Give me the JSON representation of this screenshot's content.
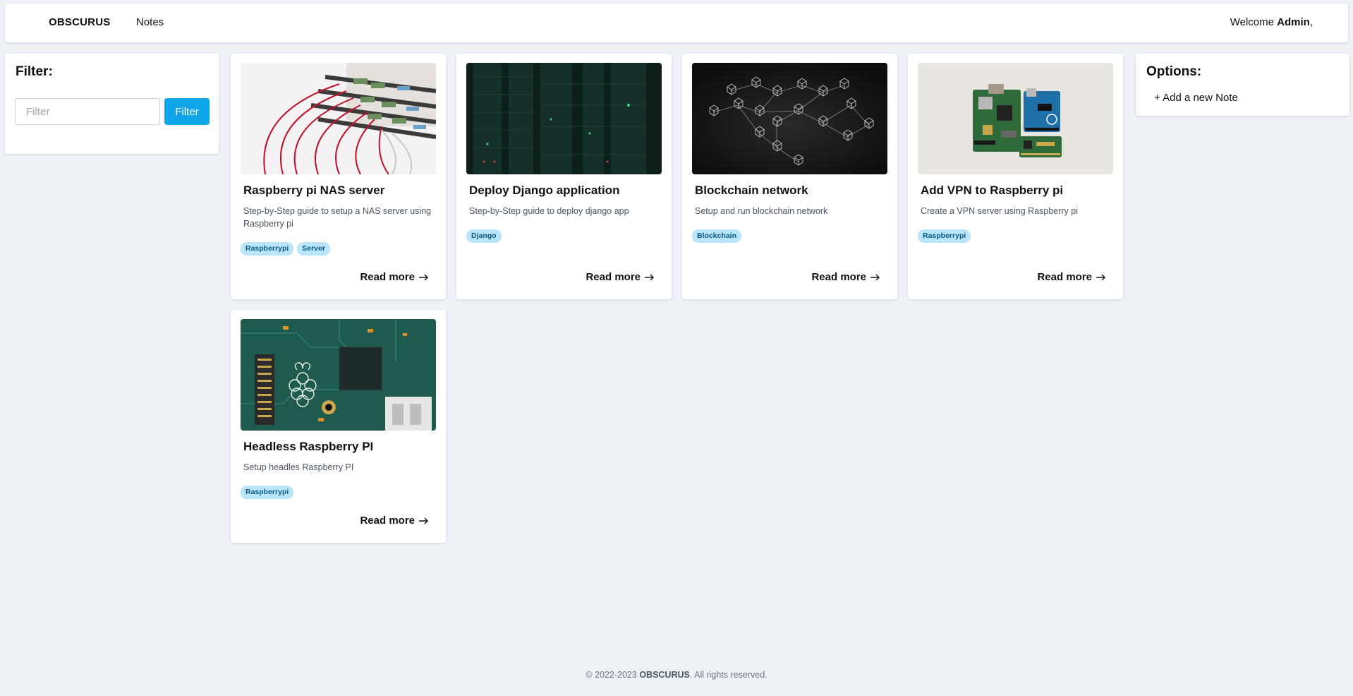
{
  "header": {
    "brand": "OBSCURUS",
    "nav_notes": "Notes",
    "welcome_prefix": "Welcome ",
    "user": "Admin",
    "welcome_suffix": ","
  },
  "filter": {
    "title": "Filter:",
    "placeholder": "Filter",
    "button": "Filter"
  },
  "options": {
    "title": "Options:",
    "add_note": "+ Add a new Note"
  },
  "cards": [
    {
      "title": "Raspberry pi NAS server",
      "description": "Step-by-Step guide to setup a NAS server using Raspberry pi",
      "tags": [
        "Raspberrypi",
        "Server"
      ],
      "read_more": "Read more",
      "image": "network-cables-image"
    },
    {
      "title": "Deploy Django application",
      "description": "Step-by-Step guide to deploy django app",
      "tags": [
        "Django"
      ],
      "read_more": "Read more",
      "image": "server-rack-image"
    },
    {
      "title": "Blockchain network",
      "description": "Setup and run blockchain network",
      "tags": [
        "Blockchain"
      ],
      "read_more": "Read more",
      "image": "blockchain-cubes-image"
    },
    {
      "title": "Add VPN to Raspberry pi",
      "description": "Create a VPN server using Raspberry pi",
      "tags": [
        "Raspberrypi"
      ],
      "read_more": "Read more",
      "image": "raspberry-boards-image"
    },
    {
      "title": "Headless Raspberry PI",
      "description": "Setup headles Raspberry PI",
      "tags": [
        "Raspberrypi"
      ],
      "read_more": "Read more",
      "image": "raspberry-pi-closeup-image"
    }
  ],
  "footer": {
    "prefix": "© 2022-2023 ",
    "brand": "OBSCURUS",
    "suffix": ". All rights reserved."
  },
  "colors": {
    "accent": "#0ea5e9",
    "tag_bg": "#bae6fd",
    "tag_text": "#075985",
    "page_bg": "#eef2f7"
  }
}
